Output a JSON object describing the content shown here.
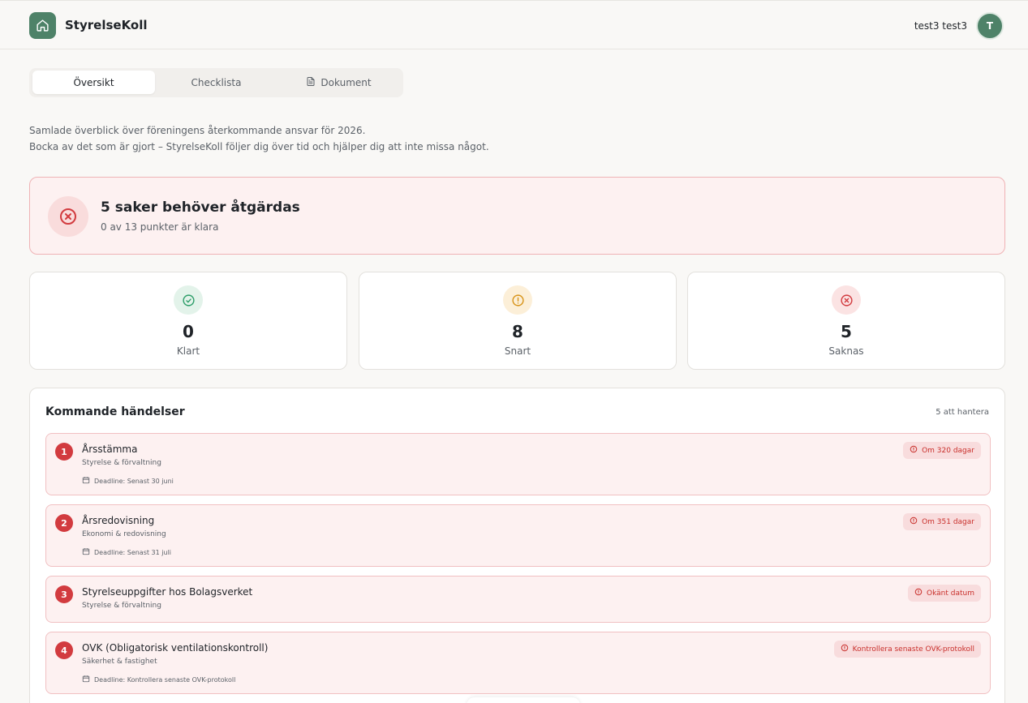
{
  "app": {
    "title": "StyrelseKoll",
    "logo_icon": "home-icon"
  },
  "user": {
    "name": "test3 test3",
    "initial": "T"
  },
  "tabs": [
    {
      "label": "Översikt",
      "active": true
    },
    {
      "label": "Checklista",
      "active": false
    },
    {
      "label": "Dokument",
      "active": false,
      "icon": "document-icon"
    }
  ],
  "intro": {
    "line1": "Samlade överblick över föreningens återkommande ansvar för 2026.",
    "line2": "Bocka av det som är gjort – StyrelseKoll följer dig över tid och hjälper dig att inte missa något."
  },
  "alert": {
    "title": "5 saker behöver åtgärdas",
    "subtitle": "0 av 13 punkter är klara",
    "icon": "x-circle-icon",
    "color": "#d23b3f"
  },
  "stats": [
    {
      "value": "0",
      "label": "Klart",
      "icon": "check-circle-icon",
      "color": "#2e9e6a",
      "bg": "#e3f3ea"
    },
    {
      "value": "8",
      "label": "Snart",
      "icon": "alert-circle-icon",
      "color": "#d8941a",
      "bg": "#fcefd8"
    },
    {
      "value": "5",
      "label": "Saknas",
      "icon": "x-circle-icon",
      "color": "#d23b3f",
      "bg": "#fbe3e3"
    }
  ],
  "events": {
    "title": "Kommande händelser",
    "count": "5 att hantera",
    "items": [
      {
        "num": "1",
        "title": "Årsstämma",
        "category": "Styrelse & förvaltning",
        "deadline": "Deadline: Senast 30 juni",
        "badge": "Om 320 dagar"
      },
      {
        "num": "2",
        "title": "Årsredovisning",
        "category": "Ekonomi & redovisning",
        "deadline": "Deadline: Senast 31 juli",
        "badge": "Om 351 dagar"
      },
      {
        "num": "3",
        "title": "Styrelseuppgifter hos Bolagsverket",
        "category": "Styrelse & förvaltning",
        "deadline": "",
        "badge": "Okänt datum"
      },
      {
        "num": "4",
        "title": "OVK (Obligatorisk ventilationskontroll)",
        "category": "Säkerhet & fastighet",
        "deadline": "Deadline: Kontrollera senaste OVK-protokoll",
        "badge": "Kontrollera senaste OVK-protokoll"
      }
    ]
  },
  "colors": {
    "accent": "#4e8268",
    "danger": "#d23b3f",
    "danger_bg": "#fdf1f1"
  }
}
